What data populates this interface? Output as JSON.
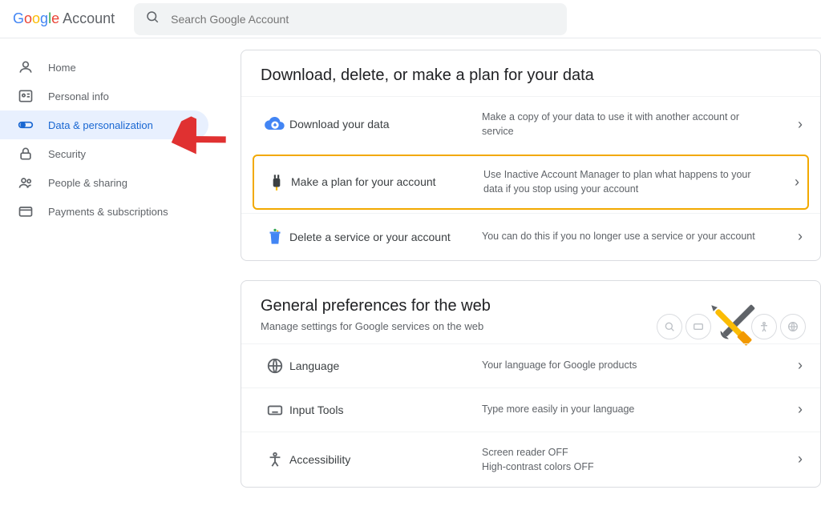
{
  "header": {
    "product": "Account",
    "search_placeholder": "Search Google Account"
  },
  "sidebar": {
    "items": [
      {
        "label": "Home"
      },
      {
        "label": "Personal info"
      },
      {
        "label": "Data & personalization"
      },
      {
        "label": "Security"
      },
      {
        "label": "People & sharing"
      },
      {
        "label": "Payments & subscriptions"
      }
    ]
  },
  "card_data": {
    "title": "Download, delete, or make a plan for your data",
    "rows": [
      {
        "label": "Download your data",
        "desc": "Make a copy of your data to use it with another account or service"
      },
      {
        "label": "Make a plan for your account",
        "desc": "Use Inactive Account Manager to plan what happens to your data if you stop using your account"
      },
      {
        "label": "Delete a service or your account",
        "desc": "You can do this if you no longer use a service or your account"
      }
    ]
  },
  "card_prefs": {
    "title": "General preferences for the web",
    "sub": "Manage settings for Google services on the web",
    "rows": [
      {
        "label": "Language",
        "desc": "Your language for Google products"
      },
      {
        "label": "Input Tools",
        "desc": "Type more easily in your language"
      },
      {
        "label": "Accessibility",
        "desc_lines": [
          "Screen reader OFF",
          "High-contrast colors OFF"
        ]
      }
    ]
  }
}
